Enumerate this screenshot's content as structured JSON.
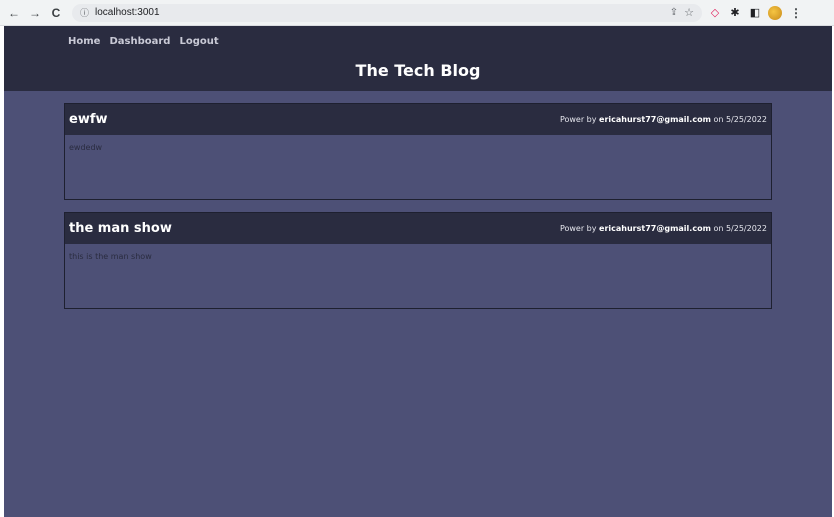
{
  "browser": {
    "url": "localhost:3001",
    "back_glyph": "←",
    "forward_glyph": "→",
    "reload_glyph": "C",
    "info_glyph": "ⓘ",
    "share_glyph": "⇪",
    "star_glyph": "☆",
    "menu_glyph": "⋮"
  },
  "site": {
    "nav": [
      "Home",
      "Dashboard",
      "Logout"
    ],
    "title": "The Tech Blog"
  },
  "posts": [
    {
      "title": "ewfw",
      "meta_prefix": "Power by ",
      "author": "ericahurst77@gmail.com",
      "meta_mid": " on ",
      "date": "5/25/2022",
      "body": "ewdedw"
    },
    {
      "title": "the man show",
      "meta_prefix": "Power by ",
      "author": "ericahurst77@gmail.com",
      "meta_mid": " on ",
      "date": "5/25/2022",
      "body": "this is the man show"
    }
  ],
  "colors": {
    "page_bg": "#4d5076",
    "header_bg": "#2a2c40"
  }
}
